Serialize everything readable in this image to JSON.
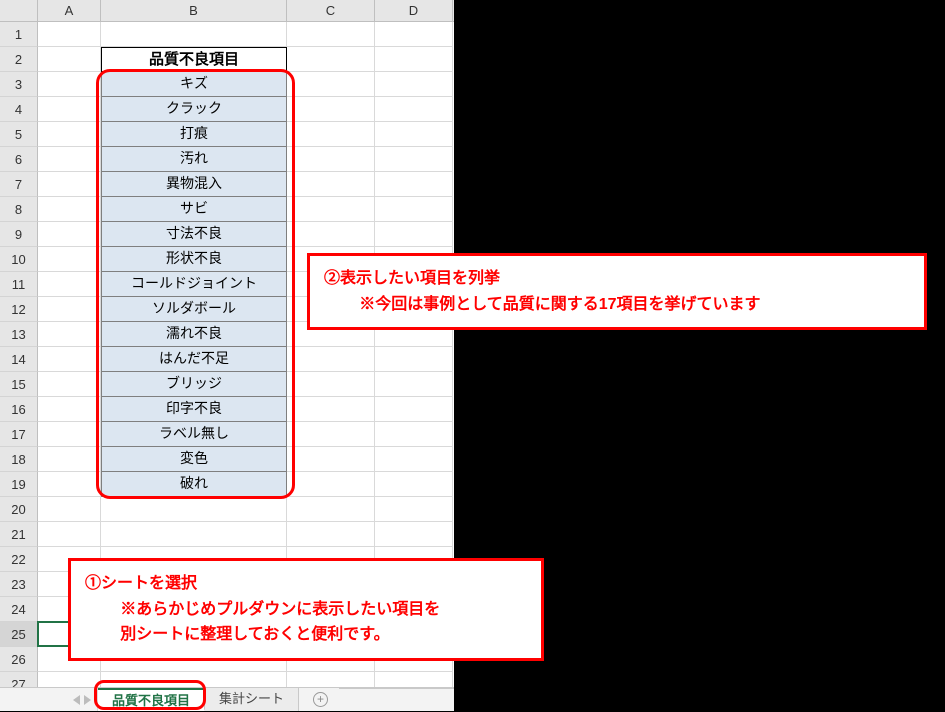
{
  "columns": {
    "A": "A",
    "B": "B",
    "C": "C",
    "D": "D"
  },
  "rows": [
    "1",
    "2",
    "3",
    "4",
    "5",
    "6",
    "7",
    "8",
    "9",
    "10",
    "11",
    "12",
    "13",
    "14",
    "15",
    "16",
    "17",
    "18",
    "19",
    "20",
    "21",
    "22",
    "23",
    "24",
    "25",
    "26",
    "27"
  ],
  "header_cell": "品質不良項目",
  "items": [
    "キズ",
    "クラック",
    "打痕",
    "汚れ",
    "異物混入",
    "サビ",
    "寸法不良",
    "形状不良",
    "コールドジョイント",
    "ソルダボール",
    "濡れ不良",
    "はんだ不足",
    "ブリッジ",
    "印字不良",
    "ラベル無し",
    "変色",
    "破れ"
  ],
  "annotations": {
    "a2_line1": "②表示したい項目を列挙",
    "a2_line2": "※今回は事例として品質に関する17項目を挙げています",
    "a1_line1": "①シートを選択",
    "a1_line2": "※あらかじめプルダウンに表示したい項目を",
    "a1_line3": "別シートに整理しておくと便利です。"
  },
  "tabs": {
    "active": "品質不良項目",
    "other": "集計シート"
  }
}
